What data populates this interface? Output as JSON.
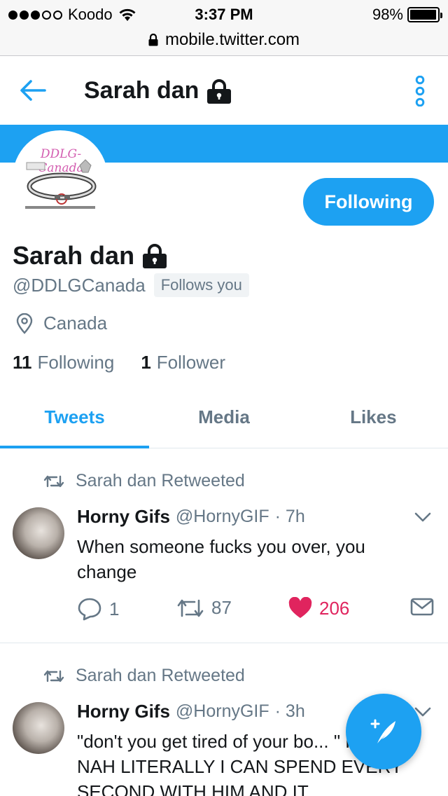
{
  "status_bar": {
    "carrier": "Koodo",
    "time": "3:37 PM",
    "battery": "98%",
    "battery_level": 0.98,
    "signal_bars": 3,
    "signal_total": 5
  },
  "browser": {
    "url": "mobile.twitter.com"
  },
  "nav": {
    "title": "Sarah dan"
  },
  "profile": {
    "avatar_text": "DDLG-Canada",
    "name": "Sarah dan",
    "handle": "@DDLGCanada",
    "follows_you": "Follows you",
    "location": "Canada",
    "following_count": "11",
    "following_label": "Following",
    "followers_count": "1",
    "followers_label": "Follower",
    "follow_button": "Following"
  },
  "tabs": [
    {
      "label": "Tweets",
      "active": true
    },
    {
      "label": "Media",
      "active": false
    },
    {
      "label": "Likes",
      "active": false
    }
  ],
  "tweets": [
    {
      "retweeted_by": "Sarah dan Retweeted",
      "author": "Horny Gifs",
      "handle": "@HornyGIF",
      "time": "· 7h",
      "text": "When someone fucks you over, you change",
      "replies": "1",
      "retweets": "87",
      "likes": "206"
    },
    {
      "retweeted_by": "Sarah dan Retweeted",
      "author": "Horny Gifs",
      "handle": "@HornyGIF",
      "time": "· 3h",
      "text": "\"don't you get tired of your bo... \" HELL NAH LITERALLY I CAN SPEND EVERY SECOND WITH HIM AND IT"
    }
  ],
  "colors": {
    "brand": "#1da1f2",
    "like": "#e0245e",
    "muted": "#657786",
    "text": "#14171a"
  }
}
